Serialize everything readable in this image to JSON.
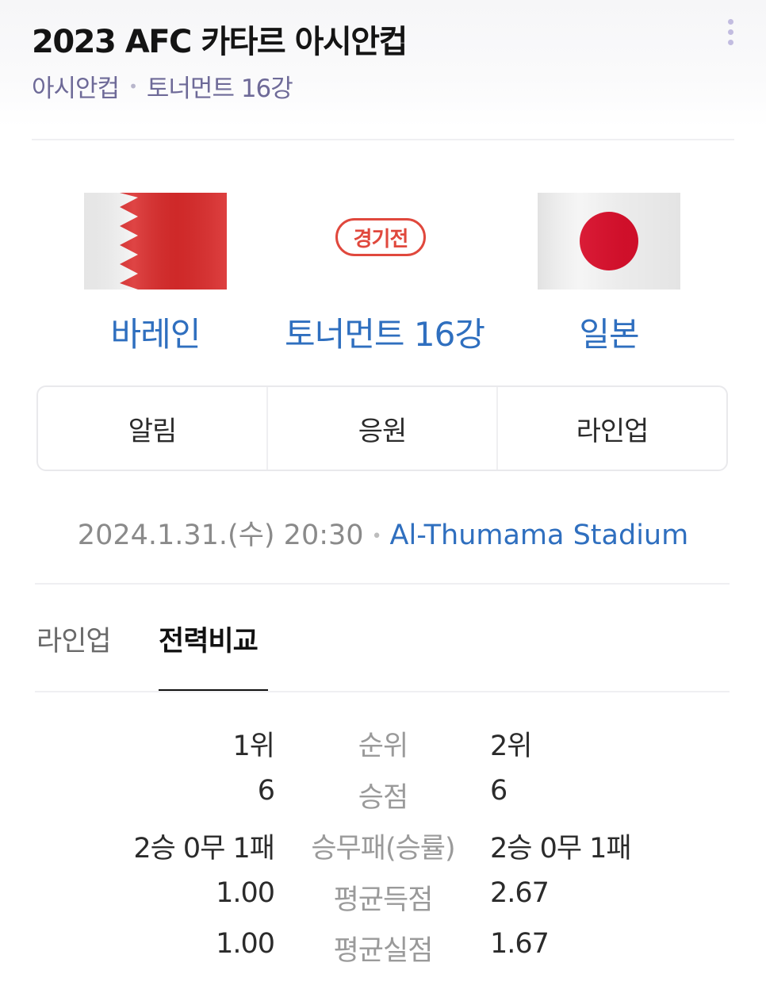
{
  "header": {
    "title": "2023 AFC 카타르 아시안컵",
    "breadcrumb": [
      "아시안컵",
      "토너먼트 16강"
    ],
    "more_icon": "more-vertical-icon"
  },
  "match": {
    "status": "경기전",
    "round": "토너먼트 16강",
    "home": {
      "name": "바레인",
      "flag": "bahrain-flag"
    },
    "away": {
      "name": "일본",
      "flag": "japan-flag"
    },
    "datetime": "2024.1.31.(수) 20:30",
    "venue": "Al-Thumama Stadium"
  },
  "actions": [
    "알림",
    "응원",
    "라인업"
  ],
  "tabs": [
    {
      "label": "라인업",
      "active": false
    },
    {
      "label": "전력비교",
      "active": true
    }
  ],
  "stats": [
    {
      "label": "순위",
      "home": "1위",
      "away": "2위"
    },
    {
      "label": "승점",
      "home": "6",
      "away": "6"
    },
    {
      "label": "승무패(승률)",
      "home": "2승 0무 1패",
      "away": "2승 0무 1패"
    },
    {
      "label": "평균득점",
      "home": "1.00",
      "away": "2.67"
    },
    {
      "label": "평균실점",
      "home": "1.00",
      "away": "1.67"
    }
  ],
  "colors": {
    "accent_blue": "#2f6fbf",
    "status_red": "#e0483d",
    "bahrain_red": "#da2b2b",
    "japan_red": "#d8102c"
  }
}
